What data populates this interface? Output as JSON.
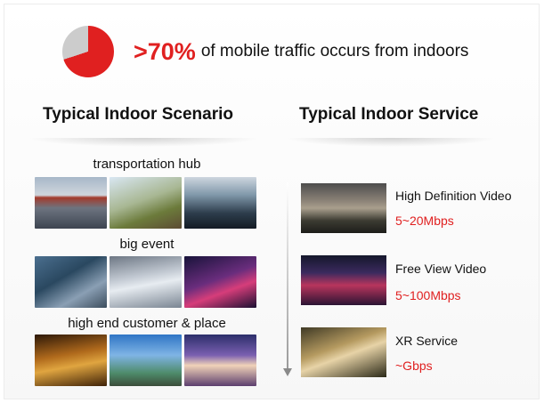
{
  "headline": {
    "percent": ">70%",
    "text": "of mobile traffic occurs from indoors",
    "pie_share": 0.7
  },
  "columns": {
    "left_title": "Typical Indoor Scenario",
    "right_title": "Typical Indoor Service"
  },
  "scenarios": [
    {
      "label": "transportation hub"
    },
    {
      "label": "big event"
    },
    {
      "label": "high end customer & place"
    }
  ],
  "services": [
    {
      "name": "High Definition Video",
      "rate": "5~20Mbps"
    },
    {
      "name": "Free View Video",
      "rate": "5~100Mbps"
    },
    {
      "name": "XR Service",
      "rate": "~Gbps"
    }
  ],
  "colors": {
    "accent": "#e02020",
    "pie_rest": "#cccccc"
  }
}
